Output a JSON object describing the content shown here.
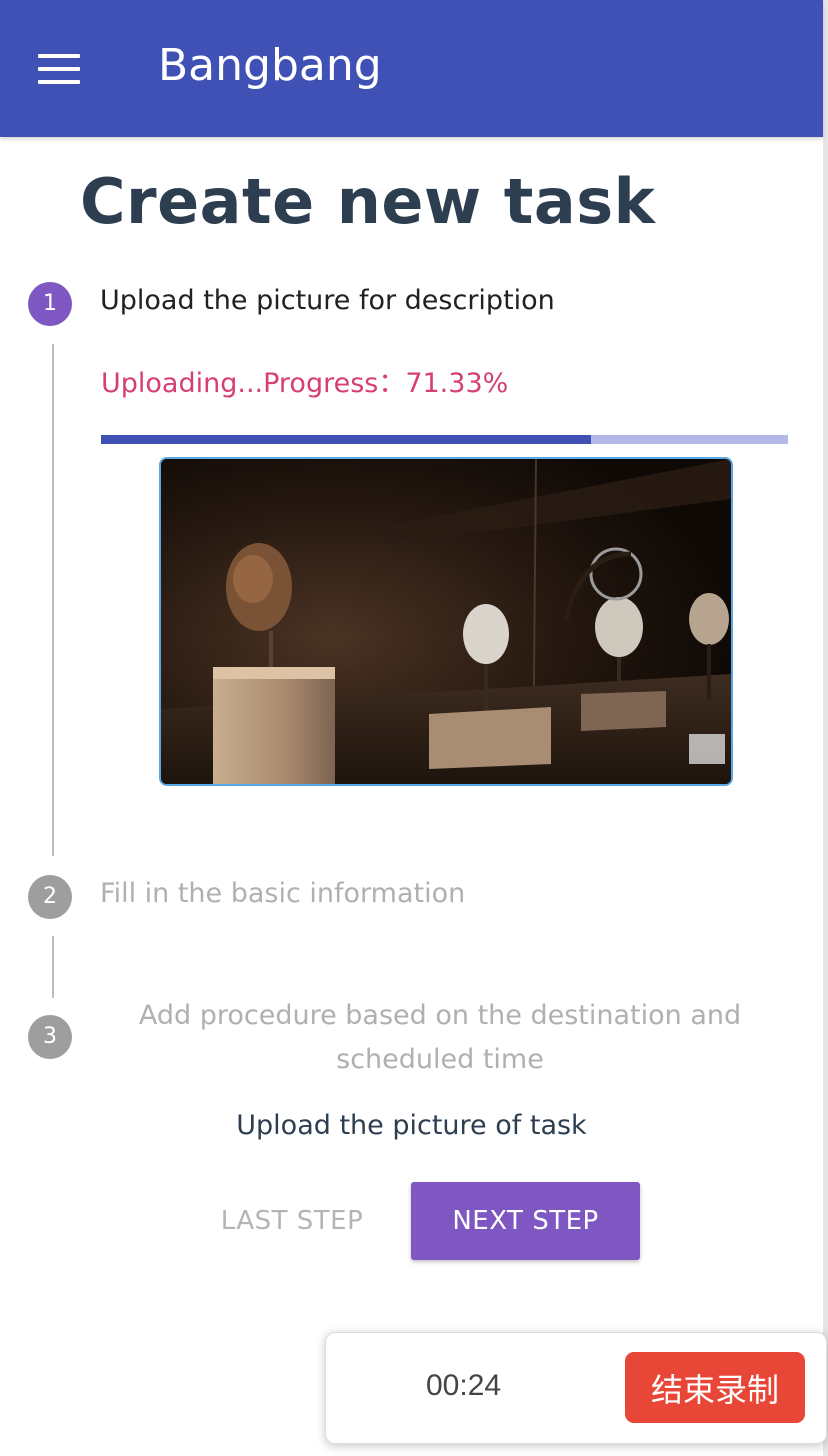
{
  "app": {
    "title": "Bangbang"
  },
  "page": {
    "title": "Create new task"
  },
  "steps": [
    {
      "number": "1",
      "label": "Upload the picture for description",
      "state": "active"
    },
    {
      "number": "2",
      "label": "Fill in the basic information",
      "state": "inactive"
    },
    {
      "number": "3",
      "label": "Add procedure based on the destination and scheduled time",
      "state": "inactive"
    }
  ],
  "upload": {
    "status_text": "Uploading...Progress：71.33%",
    "progress_percent": 71.33
  },
  "step_caption": "Upload the picture of task",
  "buttons": {
    "last_step": "LAST STEP",
    "next_step": "NEXT STEP"
  },
  "recorder": {
    "time": "00:24",
    "stop_label": "结束录制"
  },
  "colors": {
    "app_bar": "#3f51b5",
    "active_step": "#7e57c2",
    "inactive_step": "#9e9e9e",
    "upload_status": "#d63f6f",
    "stop_button": "#e84637"
  },
  "icons": {
    "menu": "menu-icon"
  }
}
